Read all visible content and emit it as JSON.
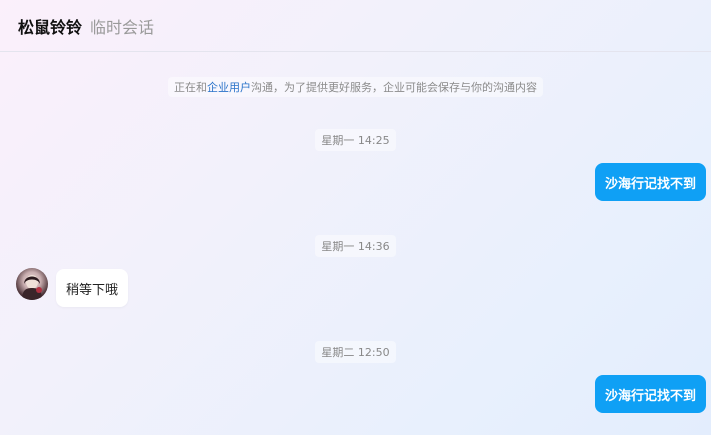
{
  "header": {
    "contact_name": "松鼠铃铃",
    "session_type": "临时会话"
  },
  "notice": {
    "prefix": "正在和",
    "link": "企业用户",
    "suffix": "沟通，为了提供更好服务，企业可能会保存与你的沟通内容"
  },
  "messages": [
    {
      "time": "星期一 14:25",
      "direction": "out",
      "text": "沙海行记找不到"
    },
    {
      "time": "星期一 14:36",
      "direction": "in",
      "text": "稍等下哦"
    },
    {
      "time": "星期二 12:50",
      "direction": "out",
      "text": "沙海行记找不到"
    }
  ],
  "colors": {
    "out_bubble": "#0fa0f5",
    "in_bubble": "#ffffff",
    "link": "#2a73c9"
  }
}
